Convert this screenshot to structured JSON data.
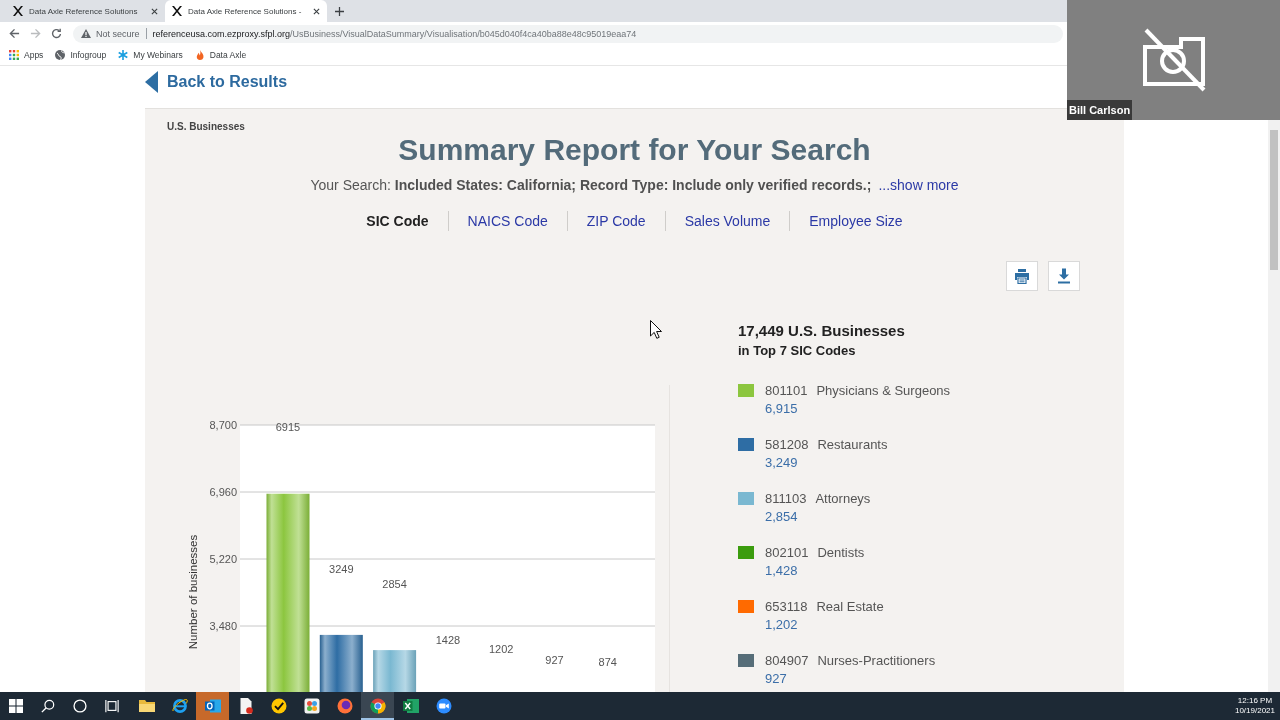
{
  "browser": {
    "tabs": [
      {
        "title": "Data Axle Reference Solutions",
        "selected": false
      },
      {
        "title": "Data Axle Reference Solutions -",
        "selected": true
      }
    ],
    "nav_buttons": [
      {
        "kind": "back",
        "disabled": false
      },
      {
        "kind": "forward",
        "disabled": true
      },
      {
        "kind": "reload",
        "disabled": false
      }
    ],
    "address": {
      "security": "Not secure",
      "host": "referenceusa.com.ezproxy.sfpl.org",
      "path": "/UsBusiness/VisualDataSummary/Visualisation/b045d040f4ca40ba88e48c95019eaa74"
    },
    "bookmarks": [
      {
        "kind": "apps",
        "label": "Apps"
      },
      {
        "kind": "globe",
        "label": "Infogroup"
      },
      {
        "kind": "snowflake",
        "label": "My Webinars"
      },
      {
        "kind": "flame",
        "label": "Data Axle"
      }
    ]
  },
  "page": {
    "back_link": "Back to Results",
    "section_label": "U.S. Businesses",
    "title": "Summary Report for Your Search",
    "search": {
      "text": "Your Search: **Included States: California; Record Type: Include only verified records.;**",
      "more": "...show more"
    },
    "tabs": [
      {
        "label": "SIC Code",
        "selected": true
      },
      {
        "label": "NAICS Code",
        "selected": false
      },
      {
        "label": "ZIP Code",
        "selected": false
      },
      {
        "label": "Sales Volume",
        "selected": false
      },
      {
        "label": "Employee Size",
        "selected": false
      }
    ],
    "actions": [
      {
        "kind": "print"
      },
      {
        "kind": "download"
      }
    ],
    "chart_data": {
      "type": "bar",
      "ylabel": "Number of businesses",
      "values": [
        6915,
        3249,
        2854,
        null,
        null,
        null,
        null
      ],
      "ylim": [
        1740,
        8700
      ],
      "yticks": [
        {
          "value": 3480,
          "label": "3,480"
        },
        {
          "value": 5220,
          "label": "5,220"
        },
        {
          "value": 6960,
          "label": "6,960"
        },
        {
          "value": 8700,
          "label": "8,700"
        }
      ],
      "grid": true,
      "annotations": [
        "6915",
        "3249",
        "2854",
        "1428",
        "1202",
        "927",
        "874"
      ]
    },
    "summary": {
      "total": "17,449 U.S. Businesses",
      "subtitle": "in Top 7 SIC Codes"
    },
    "legend": [
      {
        "code": "801101",
        "name": "Physicians & Surgeons",
        "count": "6,915",
        "color": "#8cc63f"
      },
      {
        "code": "581208",
        "name": "Restaurants",
        "count": "3,249",
        "color": "#2e6da4"
      },
      {
        "code": "811103",
        "name": "Attorneys",
        "count": "2,854",
        "color": "#7ab8d1"
      },
      {
        "code": "802101",
        "name": "Dentists",
        "count": "1,428",
        "color": "#3b9c0e"
      },
      {
        "code": "653118",
        "name": "Real Estate",
        "count": "1,202",
        "color": "#ff6a00"
      },
      {
        "code": "804907",
        "name": "Nurses-Practitioners",
        "count": "927",
        "color": "#566d78"
      }
    ]
  },
  "video_tile": {
    "name": "Bill Carlson"
  },
  "taskbar": {
    "apps": [
      {
        "kind": "folder",
        "selected": false,
        "flashing": false
      },
      {
        "kind": "ring",
        "selected": false,
        "flashing": false
      },
      {
        "kind": "mail",
        "selected": false,
        "flashing": true
      },
      {
        "kind": "document",
        "selected": false,
        "flashing": false
      },
      {
        "kind": "check",
        "selected": false,
        "flashing": false
      },
      {
        "kind": "tile",
        "selected": false,
        "flashing": false
      },
      {
        "kind": "swirl",
        "selected": false,
        "flashing": false
      },
      {
        "kind": "segments",
        "selected": true,
        "flashing": false
      },
      {
        "kind": "sheet",
        "selected": false,
        "flashing": false
      },
      {
        "kind": "camera",
        "selected": false,
        "flashing": false
      }
    ],
    "time": "12:16 PM",
    "date": "10/19/2021"
  }
}
